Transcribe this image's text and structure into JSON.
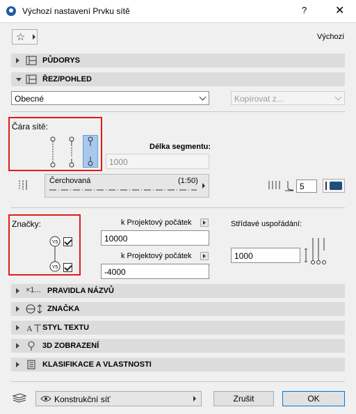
{
  "window": {
    "title": "Výchozí nastavení Prvku sítě",
    "help_label": "?",
    "close_label": "✕"
  },
  "toolbar": {
    "favorites_icon": "star-icon",
    "default_label": "Výchozí"
  },
  "sections": {
    "pudorys": "PŮDORYS",
    "rez_pohled": "ŘEZ/POHLED",
    "pravidla": "PRAVIDLA NÁZVŮ",
    "znacka": "ZNAČKA",
    "styl_textu": "STYL TEXTU",
    "zobrazeni_3d": "3D ZOBRAZENÍ",
    "klasifikace": "KLASIFIKACE A VLASTNOSTI"
  },
  "section_icon_text": {
    "pravidla": "×1..."
  },
  "rez": {
    "dropdown_value": "Obecné",
    "copy_placeholder": "Kopírovat z..."
  },
  "grid_line": {
    "label": "Čára sítě:",
    "segment_label": "Délka segmentu:",
    "segment_value": "1000",
    "linetype_name": "Čerchovaná",
    "linetype_scale": "(1:50)",
    "pen_value": "5",
    "pen_color": "#1f4e79"
  },
  "markers": {
    "label": "Značky:",
    "origin_label_1": "k Projektový počátek",
    "origin_value_1": "10000",
    "origin_label_2": "k Projektový počátek",
    "origin_value_2": "-4000",
    "bubble_text": "Y5",
    "staggered_label": "Střídavé uspořádání:",
    "staggered_value": "1000"
  },
  "footer": {
    "layer_name": "Konstrukční síť",
    "cancel_label": "Zrušit",
    "ok_label": "OK"
  }
}
